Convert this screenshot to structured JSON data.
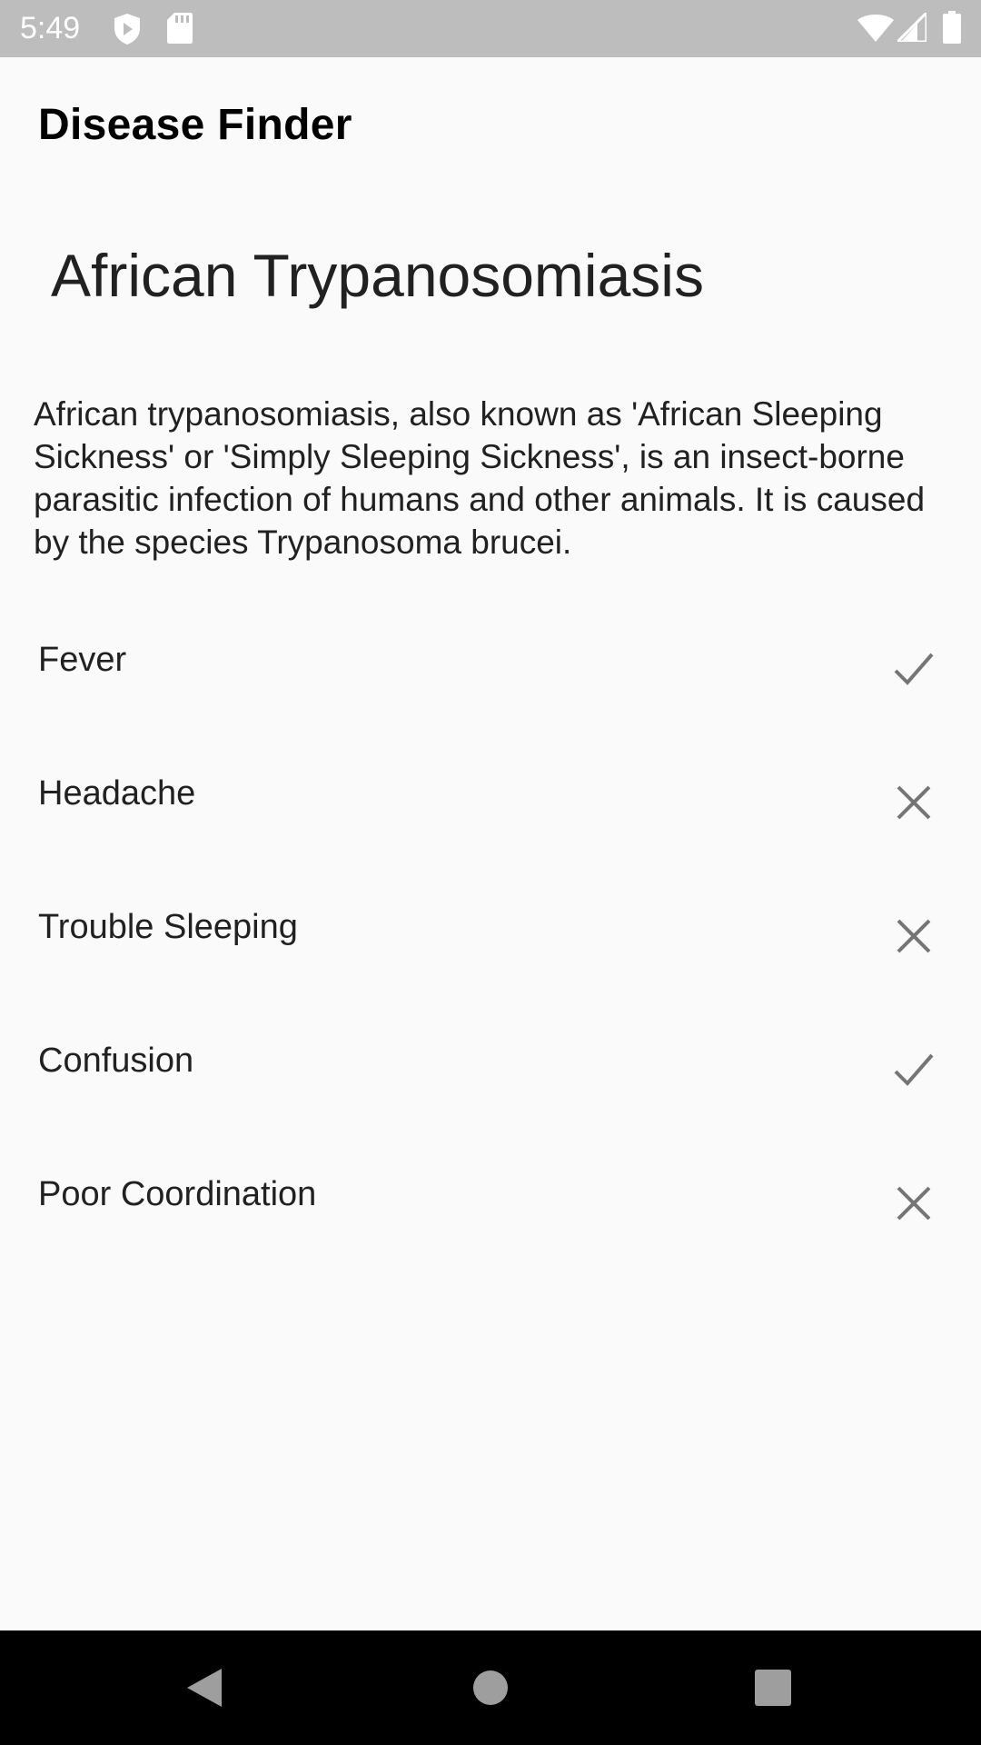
{
  "status_bar": {
    "time": "5:49",
    "left_icons": [
      "shield-icon",
      "sd-card-icon"
    ],
    "right_icons": [
      "wifi-icon",
      "cell-signal-icon",
      "battery-icon"
    ]
  },
  "app_bar": {
    "title": "Disease Finder"
  },
  "disease": {
    "name": "African Trypanosomiasis",
    "description": "African trypanosomiasis, also known as 'African Sleeping Sickness' or 'Simply Sleeping Sickness', is an insect-borne parasitic infection of humans and other animals. It is caused by the species Trypanosoma brucei."
  },
  "symptoms": [
    {
      "label": "Fever",
      "icon": "check-icon"
    },
    {
      "label": "Headache",
      "icon": "close-icon"
    },
    {
      "label": "Trouble Sleeping",
      "icon": "close-icon"
    },
    {
      "label": "Confusion",
      "icon": "check-icon"
    },
    {
      "label": "Poor Coordination",
      "icon": "close-icon"
    }
  ],
  "nav_bar": {
    "buttons": [
      "back-icon",
      "home-icon",
      "recents-icon"
    ]
  },
  "colors": {
    "status_bar_bg": "#bdbdbd",
    "page_bg": "#fafafa",
    "text": "#212121",
    "icon_grey": "#757575",
    "nav_bar_bg": "#000000"
  }
}
